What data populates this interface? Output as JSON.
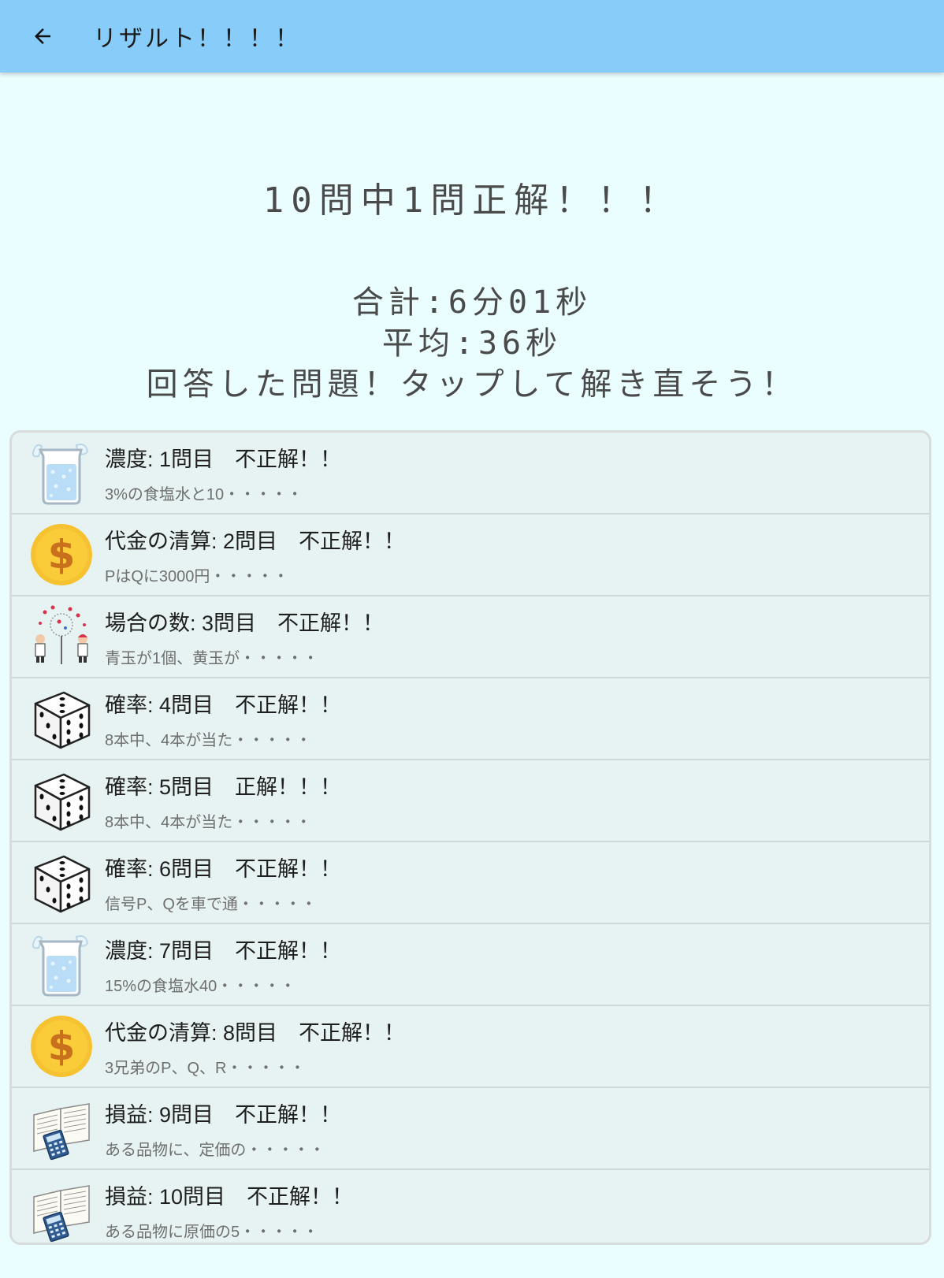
{
  "appbar": {
    "title": "リザルト！！！！",
    "back_icon": "arrow-left-icon"
  },
  "summary": {
    "score_text": "10問中1問正解！！！",
    "total_time": "合計:6分01秒",
    "average_time": "平均:36秒",
    "instruction": "回答した問題！タップして解き直そう！"
  },
  "colors": {
    "appbar": "#88cdf9",
    "background": "#eafeff",
    "list_background": "#e7f3f3"
  },
  "questions": [
    {
      "icon": "beaker-icon",
      "title": "濃度: 1問目　不正解！！",
      "snippet": "3%の食塩水と10・・・・・"
    },
    {
      "icon": "coin-icon",
      "title": "代金の清算: 2問目　不正解！！",
      "snippet": "PはQに3000円・・・・・"
    },
    {
      "icon": "lottery-icon",
      "title": "場合の数: 3問目　不正解！！",
      "snippet": "青玉が1個、黄玉が・・・・・"
    },
    {
      "icon": "dice-icon",
      "title": "確率: 4問目　不正解！！",
      "snippet": "8本中、4本が当た・・・・・"
    },
    {
      "icon": "dice-icon",
      "title": "確率: 5問目　正解！！！",
      "snippet": "8本中、4本が当た・・・・・"
    },
    {
      "icon": "dice-icon",
      "title": "確率: 6問目　不正解！！",
      "snippet": "信号P、Qを車で通・・・・・"
    },
    {
      "icon": "beaker-icon",
      "title": "濃度: 7問目　不正解！！",
      "snippet": "15%の食塩水40・・・・・"
    },
    {
      "icon": "coin-icon",
      "title": "代金の清算: 8問目　不正解！！",
      "snippet": "3兄弟のP、Q、R・・・・・"
    },
    {
      "icon": "book-calculator-icon",
      "title": "損益: 9問目　不正解！！",
      "snippet": "ある品物に、定価の・・・・・"
    },
    {
      "icon": "book-calculator-icon",
      "title": "損益: 10問目　不正解！！",
      "snippet": "ある品物に原価の5・・・・・"
    }
  ]
}
